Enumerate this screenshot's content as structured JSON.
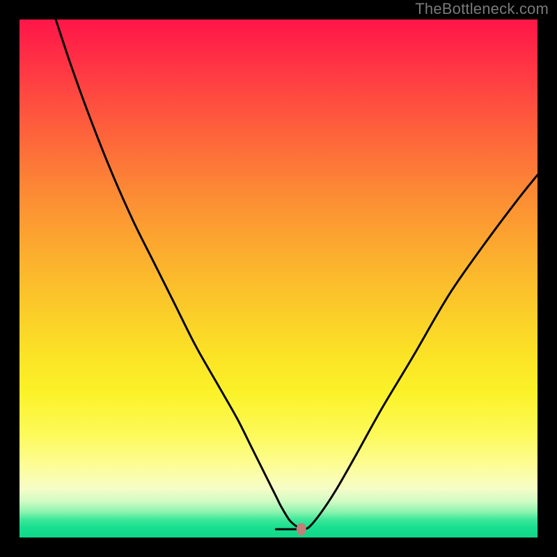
{
  "watermark": "TheBottleneck.com",
  "chart_data": {
    "type": "line",
    "title": "",
    "xlabel": "",
    "ylabel": "",
    "xlim": [
      0,
      100
    ],
    "ylim": [
      0,
      100
    ],
    "series": [
      {
        "name": "curve",
        "x": [
          7,
          10,
          14,
          18,
          22,
          26,
          30,
          34,
          38,
          42,
          45,
          47,
          48.5,
          49.5,
          50.5,
          52,
          53,
          54,
          54.4,
          55,
          56,
          58,
          61,
          65,
          70,
          76,
          83,
          90,
          96,
          100
        ],
        "y": [
          100,
          91,
          80,
          70,
          61,
          53,
          45,
          37,
          30,
          23,
          17,
          13,
          10,
          8,
          6,
          3.5,
          2.5,
          1.8,
          1.6,
          1.6,
          2.1,
          4.5,
          9,
          16,
          25,
          35,
          47,
          57,
          65,
          70
        ]
      }
    ],
    "flat_segment": {
      "x0": 49.5,
      "x1": 54.2,
      "y": 1.6
    },
    "marker": {
      "x": 54.4,
      "y": 1.6,
      "color": "#c18079"
    },
    "background_gradient": {
      "top": "#ff1648",
      "mid": "#fbe126",
      "bottom": "#0fd889"
    }
  }
}
